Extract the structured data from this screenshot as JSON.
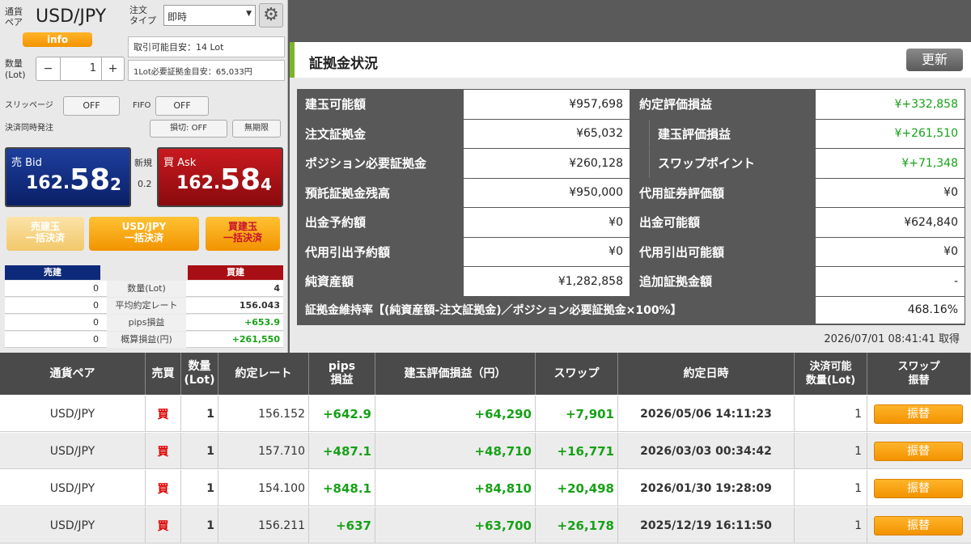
{
  "order": {
    "pair_label": "通貨\nペア",
    "pair": "USD/JPY",
    "type_label": "注文\nタイプ",
    "type_value": "即時",
    "info_label": "info",
    "tradable": "取引可能目安：14 Lot",
    "qty_label": "数量\n(Lot)",
    "qty_value": "1",
    "minus": "−",
    "plus": "+",
    "margin_needed": "1Lot必要証拠金目安：65,033円",
    "slippage_label": "スリッページ",
    "slippage_value": "OFF",
    "fifo_label": "FIFO",
    "fifo_value": "OFF",
    "simul_label": "決済同時発注",
    "stoploss": "損切: OFF",
    "unlimited": "無期限"
  },
  "rates": {
    "bid_title": "売 Bid",
    "bid_int": "162.",
    "bid_big": "58",
    "bid_small": "2",
    "new_label": "新規",
    "spread": "0.2",
    "ask_title": "買 Ask",
    "ask_int": "162.",
    "ask_big": "58",
    "ask_small": "4"
  },
  "bulk": {
    "sell_line1": "売建玉",
    "sell_line2": "一括決済",
    "pair_line1": "USD/JPY",
    "pair_line2": "一括決済",
    "buy_line1": "買建玉",
    "buy_line2": "一括決済"
  },
  "summary": {
    "sell_header": "売建",
    "buy_header": "買建",
    "rows": [
      {
        "label": "数量(Lot)",
        "sell": "0",
        "buy": "4"
      },
      {
        "label": "平均約定レート",
        "sell": "0",
        "buy": "156.043"
      },
      {
        "label": "pips損益",
        "sell": "0",
        "buy": "+653.9"
      },
      {
        "label": "概算損益(円)",
        "sell": "0",
        "buy": "+261,550"
      }
    ]
  },
  "margin": {
    "title": "証拠金状況",
    "refresh": "更新",
    "rows": [
      {
        "l1": "建玉可能額",
        "v1": "¥957,698",
        "l2": "約定評価損益",
        "v2": "¥+332,858",
        "v2green": true,
        "indent": false
      },
      {
        "l1": "注文証拠金",
        "v1": "¥65,032",
        "l2": "建玉評価損益",
        "v2": "¥+261,510",
        "v2green": true,
        "indent": true
      },
      {
        "l1": "ポジション必要証拠金",
        "v1": "¥260,128",
        "l2": "スワップポイント",
        "v2": "¥+71,348",
        "v2green": true,
        "indent": true
      },
      {
        "l1": "預託証拠金残高",
        "v1": "¥950,000",
        "l2": "代用証券評価額",
        "v2": "¥0",
        "v2green": false,
        "indent": false
      },
      {
        "l1": "出金予約額",
        "v1": "¥0",
        "l2": "出金可能額",
        "v2": "¥624,840",
        "v2green": false,
        "indent": false
      },
      {
        "l1": "代用引出予約額",
        "v1": "¥0",
        "l2": "代用引出可能額",
        "v2": "¥0",
        "v2green": false,
        "indent": false
      },
      {
        "l1": "純資産額",
        "v1": "¥1,282,858",
        "l2": "追加証拠金額",
        "v2": "-",
        "v2green": false,
        "indent": false
      }
    ],
    "ratio_label": "証拠金維持率【(純資産額-注文証拠金)／ポジション必要証拠金×100%】",
    "ratio_value": "468.16%",
    "fetched": "2026/07/01 08:41:41 取得"
  },
  "positions": {
    "headers": [
      "通貨ペア",
      "売買",
      "数量\n(Lot)",
      "約定レート",
      "pips\n損益",
      "建玉評価損益（円）",
      "スワップ",
      "約定日時",
      "決済可能\n数量(Lot)",
      "スワップ\n振替"
    ],
    "rows": [
      {
        "pair": "USD/JPY",
        "side": "買",
        "qty": "1",
        "rate": "156.152",
        "pips": "+642.9",
        "pl": "+64,290",
        "swap": "+7,901",
        "date": "2026/05/06 14:11:23",
        "closable": "1",
        "btn": "振替"
      },
      {
        "pair": "USD/JPY",
        "side": "買",
        "qty": "1",
        "rate": "157.710",
        "pips": "+487.1",
        "pl": "+48,710",
        "swap": "+16,771",
        "date": "2026/03/03 00:34:42",
        "closable": "1",
        "btn": "振替"
      },
      {
        "pair": "USD/JPY",
        "side": "買",
        "qty": "1",
        "rate": "154.100",
        "pips": "+848.1",
        "pl": "+84,810",
        "swap": "+20,498",
        "date": "2026/01/30 19:28:09",
        "closable": "1",
        "btn": "振替"
      },
      {
        "pair": "USD/JPY",
        "side": "買",
        "qty": "1",
        "rate": "156.211",
        "pips": "+637",
        "pl": "+63,700",
        "swap": "+26,178",
        "date": "2025/12/19 16:11:50",
        "closable": "1",
        "btn": "振替"
      }
    ]
  },
  "colors": {
    "accent": "#7ab52a",
    "bid": "#0d2a7a",
    "ask": "#a80f14",
    "orange": "#f29300",
    "green": "#17a117",
    "red": "#e00000"
  }
}
